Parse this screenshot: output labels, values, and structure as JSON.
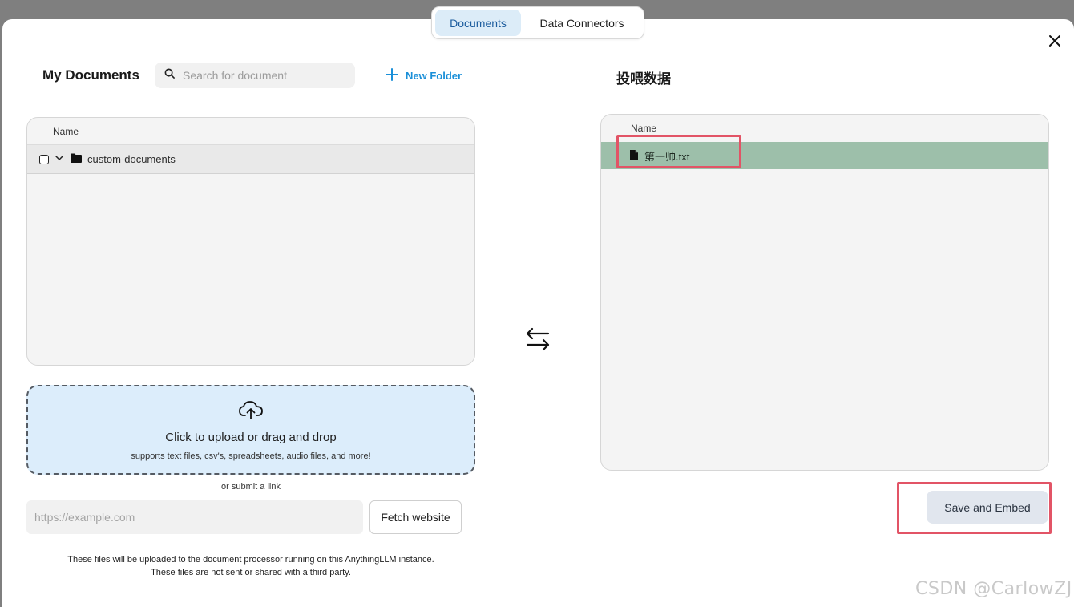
{
  "tabs": [
    {
      "label": "Documents",
      "active": true
    },
    {
      "label": "Data Connectors",
      "active": false
    }
  ],
  "left": {
    "title": "My Documents",
    "search_placeholder": "Search for document",
    "new_folder_label": "New Folder",
    "column_name": "Name",
    "folders": [
      {
        "name": "custom-documents",
        "expanded": true,
        "checked": false
      }
    ]
  },
  "upload": {
    "title": "Click to upload or drag and drop",
    "subtitle": "supports text files, csv's, spreadsheets, audio files, and more!",
    "or_link": "or submit a link",
    "url_placeholder": "https://example.com",
    "fetch_label": "Fetch website",
    "notice_line1": "These files will be uploaded to the document processor running on this AnythingLLM instance.",
    "notice_line2": "These files are not sent or shared with a third party."
  },
  "right": {
    "title": "投喂数据",
    "column_name": "Name",
    "files": [
      {
        "name": "第一帅.txt",
        "selected": true
      }
    ],
    "save_label": "Save and Embed"
  },
  "watermark": "CSDN @CarlowZJ",
  "colors": {
    "accent": "#1a8fd8",
    "active_tab_bg": "#dcecf8",
    "selected_row": "#9dbfaa",
    "dropzone_bg": "#dcedfb",
    "highlight": "#e25466"
  }
}
